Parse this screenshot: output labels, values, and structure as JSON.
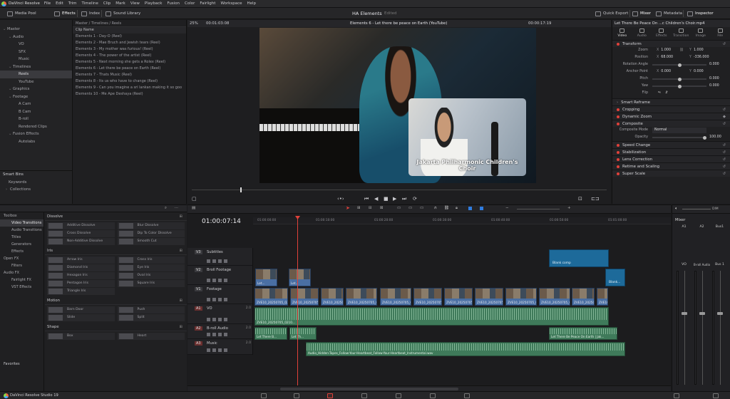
{
  "app": {
    "name": "DaVinci Resolve",
    "menu": [
      "File",
      "Edit",
      "Trim",
      "Timeline",
      "Clip",
      "Mark",
      "View",
      "Playback",
      "Fusion",
      "Color",
      "Fairlight",
      "Workspace",
      "Help"
    ]
  },
  "toolbar": {
    "left": [
      {
        "label": "Media Pool",
        "icon": "media-pool-icon"
      },
      {
        "label": "Effects",
        "icon": "effects-icon"
      },
      {
        "label": "Index",
        "icon": "index-icon"
      },
      {
        "label": "Sound Library",
        "icon": "sound-library-icon"
      }
    ],
    "project_title": "HA Elements",
    "project_status": "Edited",
    "right": [
      {
        "label": "Quick Export",
        "icon": "export-icon"
      },
      {
        "label": "Mixer",
        "icon": "mixer-icon"
      },
      {
        "label": "Metadata",
        "icon": "metadata-icon"
      },
      {
        "label": "Inspector",
        "icon": "inspector-icon"
      }
    ]
  },
  "bins": {
    "items": [
      {
        "label": "Master",
        "level": 0
      },
      {
        "label": "Audio",
        "level": 1
      },
      {
        "label": "VO",
        "level": 2
      },
      {
        "label": "SFX",
        "level": 2
      },
      {
        "label": "Music",
        "level": 2
      },
      {
        "label": "Timelines",
        "level": 1
      },
      {
        "label": "Reels",
        "level": 2,
        "selected": true
      },
      {
        "label": "YouTube",
        "level": 2
      },
      {
        "label": "Graphics",
        "level": 1
      },
      {
        "label": "Footage",
        "level": 1
      },
      {
        "label": "A Cam",
        "level": 2
      },
      {
        "label": "B Cam",
        "level": 2
      },
      {
        "label": "B-roll",
        "level": 2
      },
      {
        "label": "Rendered Clips",
        "level": 2
      },
      {
        "label": "Fusion Effects",
        "level": 1
      },
      {
        "label": "Autolabs",
        "level": 2
      }
    ],
    "smart_bins_label": "Smart Bins",
    "smart_bins": [
      "Keywords",
      "Collections"
    ]
  },
  "clip_list": {
    "breadcrumb": "Master / Timelines / Reels",
    "column_header": "Clip Name",
    "clips": [
      "Elements 1 - Day-O (Reel)",
      "Elements 2 - Mae Bruch and Jewish tears (Reel)",
      "Elements 3 - My mother was furious! (Reel)",
      "Elements 4 - The power of the artist (Reel)",
      "Elements 5 - Next morning she gets a Rolex (Reel)",
      "Elements 6 - Let there be peace on Earth (Reel)",
      "Elements 7 - Thats Music (Reel)",
      "Elements 8 - Its us who have to change (Reel)",
      "Elements 9 - Can you imagine a sri lankan making it so goo",
      "Elements 10 - Me Ape Deshaya (Reel)"
    ]
  },
  "viewer": {
    "zoom": "25%",
    "source_timecode": "00:01:03:08",
    "title": "Elements 6 - Let there be peace on Earth (YouTube)",
    "timecode": "00:00:17:19",
    "caption": "Jakarta Philharmonic Children's Choir"
  },
  "inspector": {
    "clip_title": "Let There Be Peace On ...c Children's Choir.mp4",
    "tabs": [
      "Video",
      "Audio",
      "Effects",
      "Transition",
      "Image",
      "File"
    ],
    "transform_label": "Transform",
    "zoom": {
      "label": "Zoom",
      "x": "1.000",
      "y": "1.000"
    },
    "position": {
      "label": "Position",
      "x": "68.000",
      "y": "-336.000"
    },
    "rotation": {
      "label": "Rotation Angle",
      "value": "0.000"
    },
    "anchor": {
      "label": "Anchor Point",
      "x": "0.000",
      "y": "0.000"
    },
    "pitch": {
      "label": "Pitch",
      "value": "0.000"
    },
    "yaw": {
      "label": "Yaw",
      "value": "0.000"
    },
    "flip_label": "Flip",
    "axis_x": "X",
    "axis_y": "Y",
    "smart_reframe": "Smart Reframe",
    "cropping": "Cropping",
    "dynamic_zoom": "Dynamic Zoom",
    "composite": "Composite",
    "composite_mode_label": "Composite Mode",
    "composite_mode": "Normal",
    "opacity_label": "Opacity",
    "opacity": "100.00",
    "more_sections": [
      "Speed Change",
      "Stabilization",
      "Lens Correction",
      "Retime and Scaling",
      "Super Scale"
    ]
  },
  "effects": {
    "tree": [
      {
        "label": "Toolbox",
        "level": 0
      },
      {
        "label": "Video Transitions",
        "level": 1,
        "selected": true
      },
      {
        "label": "Audio Transitions",
        "level": 1
      },
      {
        "label": "Titles",
        "level": 1
      },
      {
        "label": "Generators",
        "level": 1
      },
      {
        "label": "Effects",
        "level": 1
      },
      {
        "label": "Open FX",
        "level": 0
      },
      {
        "label": "Filters",
        "level": 1
      },
      {
        "label": "Audio FX",
        "level": 0
      },
      {
        "label": "Fairlight FX",
        "level": 1
      },
      {
        "label": "VST Effects",
        "level": 1
      }
    ],
    "favorites_label": "Favorites",
    "groups": [
      {
        "name": "Dissolve",
        "items": [
          "Additive Dissolve",
          "Blur Dissolve",
          "Cross Dissolve",
          "Dip To Color Dissolve",
          "Non-Additive Dissolve",
          "Smooth Cut"
        ]
      },
      {
        "name": "Iris",
        "items": [
          "Arrow Iris",
          "Cross Iris",
          "Diamond Iris",
          "Eye Iris",
          "Hexagon Iris",
          "Oval Iris",
          "Pentagon Iris",
          "Square Iris",
          "Triangle Iris"
        ]
      },
      {
        "name": "Motion",
        "items": [
          "Barn Door",
          "Push",
          "Slide",
          "Split"
        ]
      },
      {
        "name": "Shape",
        "items": [
          "Box",
          "Heart"
        ]
      }
    ]
  },
  "timeline": {
    "timecode": "01:00:07:14",
    "ruler": [
      "01:00:00:00",
      "01:00:10:00",
      "01:00:20:00",
      "01:00:30:00",
      "01:00:40:00",
      "01:00:50:00",
      "01:01:00:00"
    ],
    "tracks": [
      {
        "id": "V3",
        "name": "Subtitles",
        "kind": "video"
      },
      {
        "id": "V2",
        "name": "Broll Footage",
        "kind": "video"
      },
      {
        "id": "V1",
        "name": "Footage",
        "kind": "video"
      },
      {
        "id": "A1",
        "name": "VO",
        "kind": "audio",
        "level": "2.0"
      },
      {
        "id": "A2",
        "name": "B-roll Audio",
        "kind": "audio",
        "level": "2.0"
      },
      {
        "id": "A3",
        "name": "Music",
        "kind": "audio",
        "level": "2.0"
      }
    ],
    "clip_labels": {
      "subtitle": "Blank comp",
      "v2_blank": "Blank...",
      "v2_a": "Let...",
      "v2_b": "Let...",
      "v1": "ZVE10_20250705_0210.MP4",
      "v1_mp4": "ZVE10_20250705_0210.MP4",
      "a1": "ZVE10_20250705_0210...",
      "a2_a": "Let There B...",
      "a2_b": "Let Th...",
      "a2_c": "Let There Be Peace On Earth | Jak...",
      "a3": "Audio_Hidden-Tapes_Follow-Your-Heartbeat_Follow-Your-Heartbeat_Instrumental.wav"
    },
    "audio_zoom": "DIM"
  },
  "mixer": {
    "title": "Mixer",
    "channels": [
      "A1",
      "A2",
      "Bus1"
    ],
    "strip_labels": [
      "VO",
      "B-roll Audio",
      "Bus 1"
    ]
  },
  "pagebar": {
    "version": "DaVinci Resolve Studio 19"
  }
}
